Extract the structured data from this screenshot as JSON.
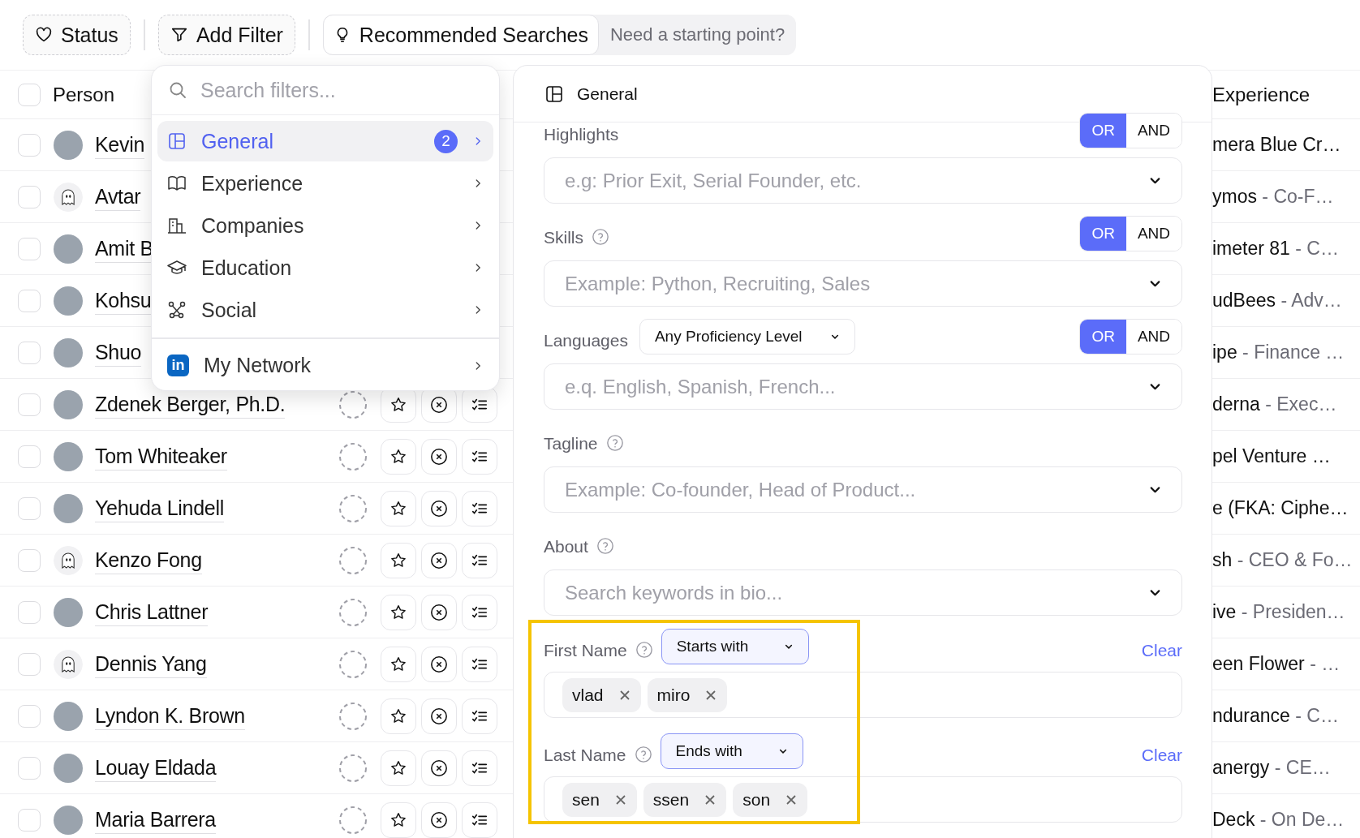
{
  "toolbar": {
    "status": "Status",
    "add_filter": "Add Filter",
    "recommended": "Recommended Searches",
    "hint": "Need a starting point?"
  },
  "table": {
    "header_checked": false,
    "columns": [
      "Person",
      "Experience"
    ],
    "rows": [
      {
        "name": "Kevin",
        "kind": "photo",
        "checked": false,
        "actions_shown": false,
        "company": "mera Blue Cr…",
        "role": ""
      },
      {
        "name": "Avtar",
        "kind": "ghost",
        "checked": false,
        "actions_shown": false,
        "company": "ymos",
        "role": "- Co-F…"
      },
      {
        "name": "Amit B",
        "kind": "photo",
        "checked": false,
        "actions_shown": false,
        "company": "imeter 81",
        "role": "- C…"
      },
      {
        "name": "Kohsu",
        "kind": "photo",
        "checked": false,
        "actions_shown": false,
        "company": "udBees",
        "role": "- Adv…"
      },
      {
        "name": "Shuo",
        "kind": "photo",
        "checked": false,
        "actions_shown": false,
        "company": "ipe",
        "role": "- Finance …"
      },
      {
        "name": "Zdenek Berger, Ph.D.",
        "kind": "photo",
        "checked": false,
        "actions_shown": true,
        "company": "derna",
        "role": "- Exec…"
      },
      {
        "name": "Tom Whiteaker",
        "kind": "photo",
        "checked": false,
        "actions_shown": true,
        "company": "pel Venture …",
        "role": ""
      },
      {
        "name": "Yehuda Lindell",
        "kind": "photo",
        "checked": false,
        "actions_shown": true,
        "company": "e (FKA: Ciphe…",
        "role": ""
      },
      {
        "name": "Kenzo Fong",
        "kind": "ghost",
        "checked": false,
        "actions_shown": true,
        "company": "sh",
        "role": "- CEO & Fo…"
      },
      {
        "name": "Chris Lattner",
        "kind": "photo",
        "checked": false,
        "actions_shown": true,
        "company": "ive",
        "role": "- Presiden…"
      },
      {
        "name": "Dennis Yang",
        "kind": "ghost",
        "checked": false,
        "actions_shown": true,
        "company": "een Flower",
        "role": "- …"
      },
      {
        "name": "Lyndon K. Brown",
        "kind": "photo",
        "checked": false,
        "actions_shown": true,
        "company": "ndurance",
        "role": "- C…"
      },
      {
        "name": "Louay Eldada",
        "kind": "photo",
        "checked": false,
        "actions_shown": true,
        "company": "anergy",
        "role": "- CE…"
      },
      {
        "name": "Maria Barrera",
        "kind": "photo",
        "checked": false,
        "actions_shown": true,
        "company": "Deck",
        "role": "- On De…"
      }
    ]
  },
  "filter_menu": {
    "search_placeholder": "Search filters...",
    "items": [
      {
        "label": "General",
        "kind": "grid",
        "selected": true,
        "badge": "2"
      },
      {
        "label": "Experience",
        "kind": "book",
        "selected": false
      },
      {
        "label": "Companies",
        "kind": "building",
        "selected": false
      },
      {
        "label": "Education",
        "kind": "cap",
        "selected": false
      },
      {
        "label": "Social",
        "kind": "nodes",
        "selected": false
      }
    ],
    "network": {
      "label": "My Network",
      "logo_text": "in"
    }
  },
  "panel": {
    "title": "General",
    "fields": [
      {
        "kind": "select",
        "label": "Highlights",
        "help": false,
        "placeholder": "e.g: Prior Exit, Serial Founder, etc.",
        "logic": [
          {
            "label": "OR",
            "selected": true
          },
          {
            "label": "AND",
            "selected": false
          }
        ]
      },
      {
        "kind": "select",
        "label": "Skills",
        "help": true,
        "placeholder": "Example: Python, Recruiting, Sales",
        "logic": [
          {
            "label": "OR",
            "selected": true
          },
          {
            "label": "AND",
            "selected": false
          }
        ]
      },
      {
        "kind": "select",
        "label": "Languages",
        "help": false,
        "qualifier": "Any Proficiency Level",
        "placeholder": "e.q. English, Spanish, French...",
        "logic": [
          {
            "label": "OR",
            "selected": true
          },
          {
            "label": "AND",
            "selected": false
          }
        ]
      },
      {
        "kind": "select",
        "label": "Tagline",
        "help": true,
        "placeholder": "Example: Co-founder, Head of Product..."
      },
      {
        "kind": "select",
        "label": "About",
        "help": true,
        "placeholder": "Search keywords in bio..."
      }
    ],
    "name_fields": [
      {
        "kind": "chips",
        "label": "First Name",
        "help": true,
        "match": "Starts with",
        "clear": "Clear",
        "chips": [
          "vlad",
          "miro"
        ]
      },
      {
        "kind": "chips",
        "label": "Last Name",
        "help": true,
        "match": "Ends with",
        "clear": "Clear",
        "chips": [
          "sen",
          "ssen",
          "son"
        ]
      }
    ]
  }
}
